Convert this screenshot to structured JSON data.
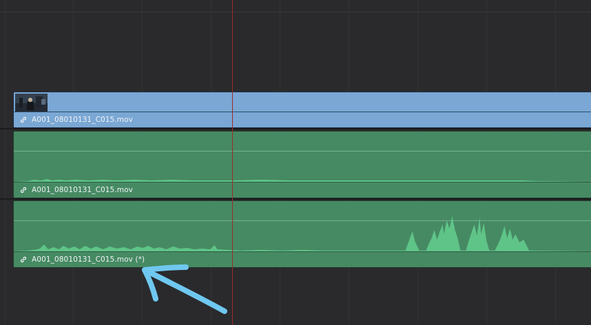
{
  "tracks": {
    "video": {
      "clip_name": "A001_08010131_C015.mov",
      "link_icon": "link-icon",
      "thumbnail": "clip-thumbnail"
    },
    "audio1": {
      "clip_name": "A001_08010131_C015.mov",
      "link_icon": "link-icon"
    },
    "audio2": {
      "clip_name": "A001_08010131_C015.mov (*)",
      "link_icon": "link-icon"
    }
  },
  "colors": {
    "video_clip": "#7aa7d4",
    "audio_clip": "#468a63",
    "waveform": "#5fc488",
    "playhead": "#9c2a2a",
    "annotation_arrow": "#6fc8ef"
  },
  "annotation": {
    "icon": "arrow-annotation"
  }
}
